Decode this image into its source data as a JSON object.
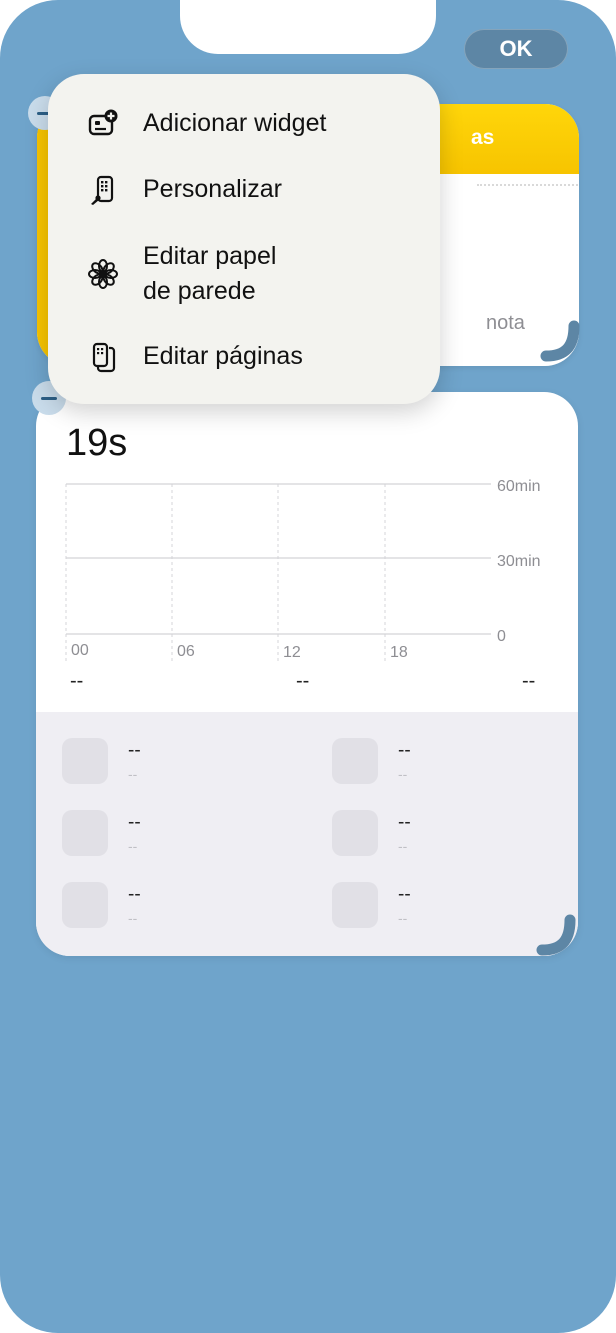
{
  "header": {
    "ok_label": "OK"
  },
  "notes_widget": {
    "title_fragment": "as",
    "placeholder_fragment": "nota"
  },
  "screen_time_widget": {
    "total": "19s",
    "y_labels": [
      "60min",
      "30min",
      "0"
    ],
    "x_labels": [
      "00",
      "06",
      "12",
      "18"
    ],
    "category_values": [
      "--",
      "--",
      "--"
    ],
    "apps": [
      {
        "name": "--",
        "time": "--"
      },
      {
        "name": "--",
        "time": "--"
      },
      {
        "name": "--",
        "time": "--"
      },
      {
        "name": "--",
        "time": "--"
      },
      {
        "name": "--",
        "time": "--"
      },
      {
        "name": "--",
        "time": "--"
      }
    ]
  },
  "context_menu": {
    "items": [
      {
        "label": "Adicionar widget",
        "icon": "add-widget-icon"
      },
      {
        "label": "Personalizar",
        "icon": "customize-icon"
      },
      {
        "label": "Editar papel\nde parede",
        "label_line1": "Editar papel",
        "label_line2": "de parede",
        "icon": "wallpaper-flower-icon"
      },
      {
        "label": "Editar páginas",
        "icon": "pages-icon"
      }
    ]
  },
  "colors": {
    "wallpaper": "#6fa4cb",
    "notes_accent": "#ffd60a",
    "ok_button": "#5d86a5"
  }
}
